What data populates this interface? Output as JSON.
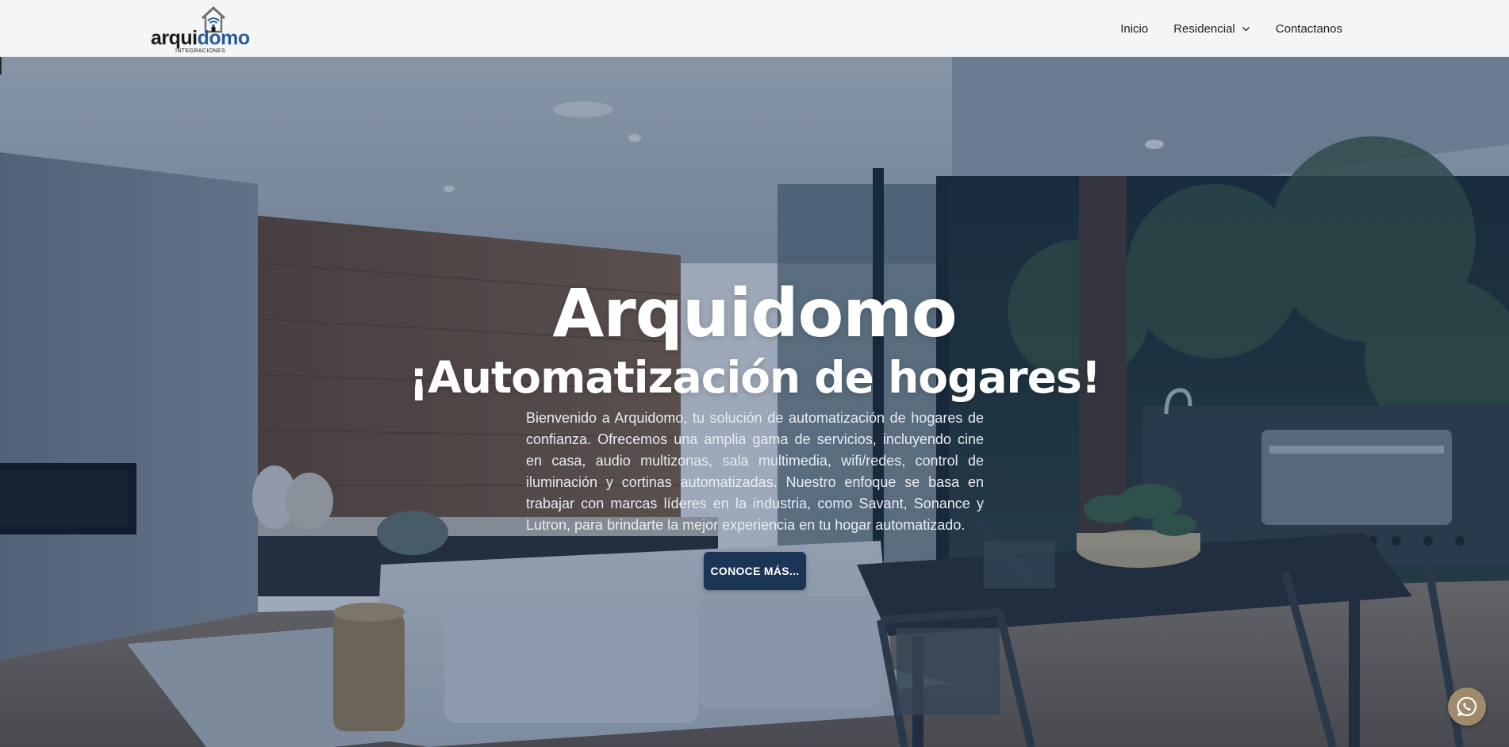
{
  "brand": {
    "logo_text_a": "arqui",
    "logo_text_b": "domo",
    "logo_sub": "INTEGRACIONES",
    "logo_icon": "house-wifi-icon"
  },
  "nav": {
    "items": [
      {
        "label": "Inicio"
      },
      {
        "label": "Residencial",
        "icon": "chevron-down-icon"
      },
      {
        "label": "Contactanos"
      }
    ]
  },
  "hero": {
    "title": "Arquidomo",
    "subtitle": "¡Automatización de hogares!",
    "body": "Bienvenido a Arquidomo, tu solución de automatización de hogares de confianza. Ofrecemos una amplia gama de servicios, incluyendo cine en casa, audio multizonas, sala multimedia, wifi/redes, control de iluminación y cortinas automatizadas. Nuestro enfoque se basa en trabajar con marcas líderes en la industria, como Savant, Sonance y Lutron, para brindarte la mejor experiencia en tu hogar automatizado.",
    "cta_label": "CONOCE MÁS..."
  },
  "floating": {
    "whatsapp_icon": "whatsapp-icon"
  },
  "colors": {
    "header_bg": "#f4f5f7",
    "brand_blue": "#2b5d97",
    "overlay": "#163056",
    "cta_bg": "#1b3557",
    "whatsapp_bg": "#a08a6a"
  }
}
